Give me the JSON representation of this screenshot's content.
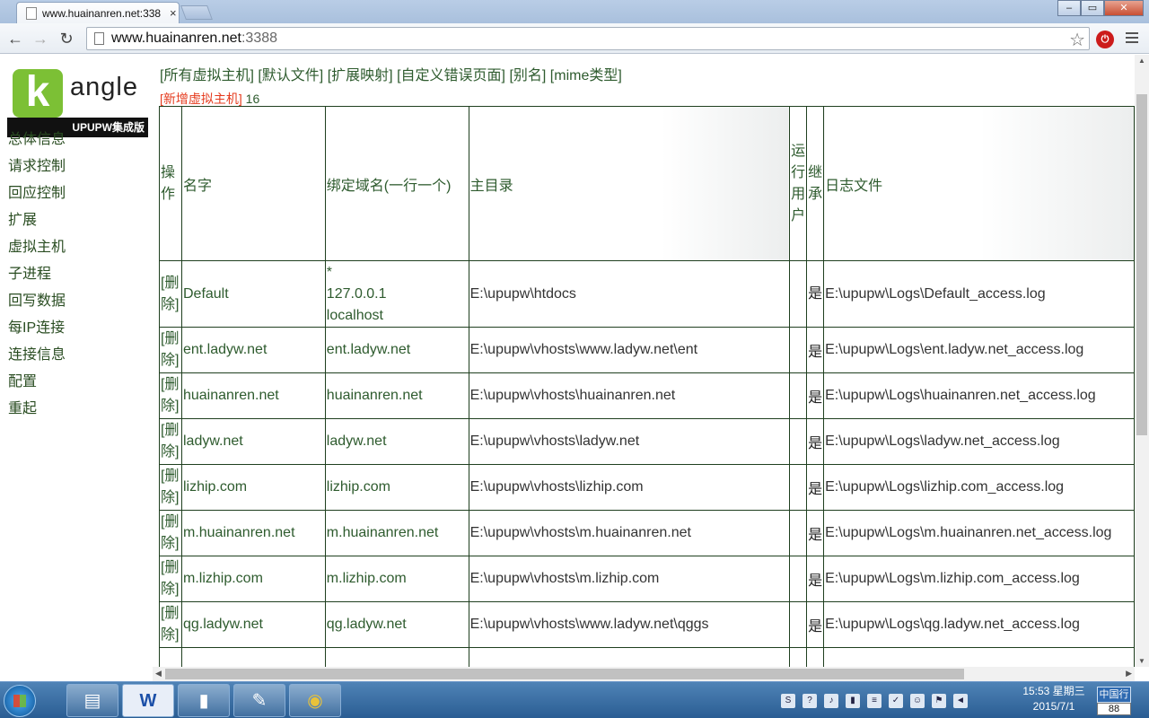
{
  "browser": {
    "tab_title": "www.huainanren.net:338",
    "tab_close": "×",
    "url_host": "www.huainanren.net",
    "url_port": ":3388",
    "back": "←",
    "forward": "→",
    "reload": "↻",
    "star": "☆",
    "window_min": "–",
    "window_max": "▭",
    "window_close": "✕"
  },
  "logo": {
    "letter": "k",
    "rest": "angle",
    "subtitle": "UPUPW集成版"
  },
  "sidebar": {
    "items": [
      {
        "label": "总体信息"
      },
      {
        "label": "请求控制"
      },
      {
        "label": "回应控制"
      },
      {
        "label": "扩展"
      },
      {
        "label": "虚拟主机"
      },
      {
        "label": "子进程"
      },
      {
        "label": "回写数据"
      },
      {
        "label": "每IP连接"
      },
      {
        "label": "连接信息"
      },
      {
        "label": "配置"
      },
      {
        "label": "重起"
      }
    ]
  },
  "top_links": [
    {
      "label": "[所有虚拟主机]"
    },
    {
      "label": "[默认文件]"
    },
    {
      "label": "[扩展映射]"
    },
    {
      "label": "[自定义错误页面]"
    },
    {
      "label": "[别名]"
    },
    {
      "label": "[mime类型]"
    }
  ],
  "add_vh": {
    "open": "[",
    "label": "新增虚拟主机",
    "close": "]",
    "count": "16"
  },
  "table": {
    "headers": {
      "op": "操\n作",
      "name": "名字",
      "domain": "绑定域名(一行一个)",
      "docroot": "主目录",
      "run_user": "运\n行\n用\n户",
      "inherit": "继\n承",
      "log": "日志文件"
    },
    "delete_label": "[删\n除]",
    "rows": [
      {
        "name": "Default",
        "domain": "*\n127.0.0.1\nlocalhost",
        "docroot": "E:\\upupw\\htdocs",
        "inherit": "是",
        "log": "E:\\upupw\\Logs\\Default_access.log"
      },
      {
        "name": "ent.ladyw.net",
        "domain": "ent.ladyw.net",
        "docroot": "E:\\upupw\\vhosts\\www.ladyw.net\\ent",
        "inherit": "是",
        "log": "E:\\upupw\\Logs\\ent.ladyw.net_access.log"
      },
      {
        "name": "huainanren.net",
        "domain": "huainanren.net",
        "docroot": "E:\\upupw\\vhosts\\huainanren.net",
        "inherit": "是",
        "log": "E:\\upupw\\Logs\\huainanren.net_access.log"
      },
      {
        "name": "ladyw.net",
        "domain": "ladyw.net",
        "docroot": "E:\\upupw\\vhosts\\ladyw.net",
        "inherit": "是",
        "log": "E:\\upupw\\Logs\\ladyw.net_access.log"
      },
      {
        "name": "lizhip.com",
        "domain": "lizhip.com",
        "docroot": "E:\\upupw\\vhosts\\lizhip.com",
        "inherit": "是",
        "log": "E:\\upupw\\Logs\\lizhip.com_access.log"
      },
      {
        "name": "m.huainanren.net",
        "domain": "m.huainanren.net",
        "docroot": "E:\\upupw\\vhosts\\m.huainanren.net",
        "inherit": "是",
        "log": "E:\\upupw\\Logs\\m.huainanren.net_access.log"
      },
      {
        "name": "m.lizhip.com",
        "domain": "m.lizhip.com",
        "docroot": "E:\\upupw\\vhosts\\m.lizhip.com",
        "inherit": "是",
        "log": "E:\\upupw\\Logs\\m.lizhip.com_access.log"
      },
      {
        "name": "qg.ladyw.net",
        "domain": "qg.ladyw.net",
        "docroot": "E:\\upupw\\vhosts\\www.ladyw.net\\qggs",
        "inherit": "是",
        "log": "E:\\upupw\\Logs\\qg.ladyw.net_access.log"
      }
    ]
  },
  "taskbar": {
    "apps": [
      {
        "icon": "folder-icon",
        "label": "▤"
      },
      {
        "icon": "word-icon",
        "label": "W"
      },
      {
        "icon": "terminal-icon",
        "label": "▮"
      },
      {
        "icon": "notepad-icon",
        "label": "✎"
      },
      {
        "icon": "chrome-icon",
        "label": "◉"
      }
    ],
    "clock_time": "15:53 星期三",
    "clock_date": "2015/7/1",
    "ime": "中国行",
    "ime_number": "88"
  }
}
